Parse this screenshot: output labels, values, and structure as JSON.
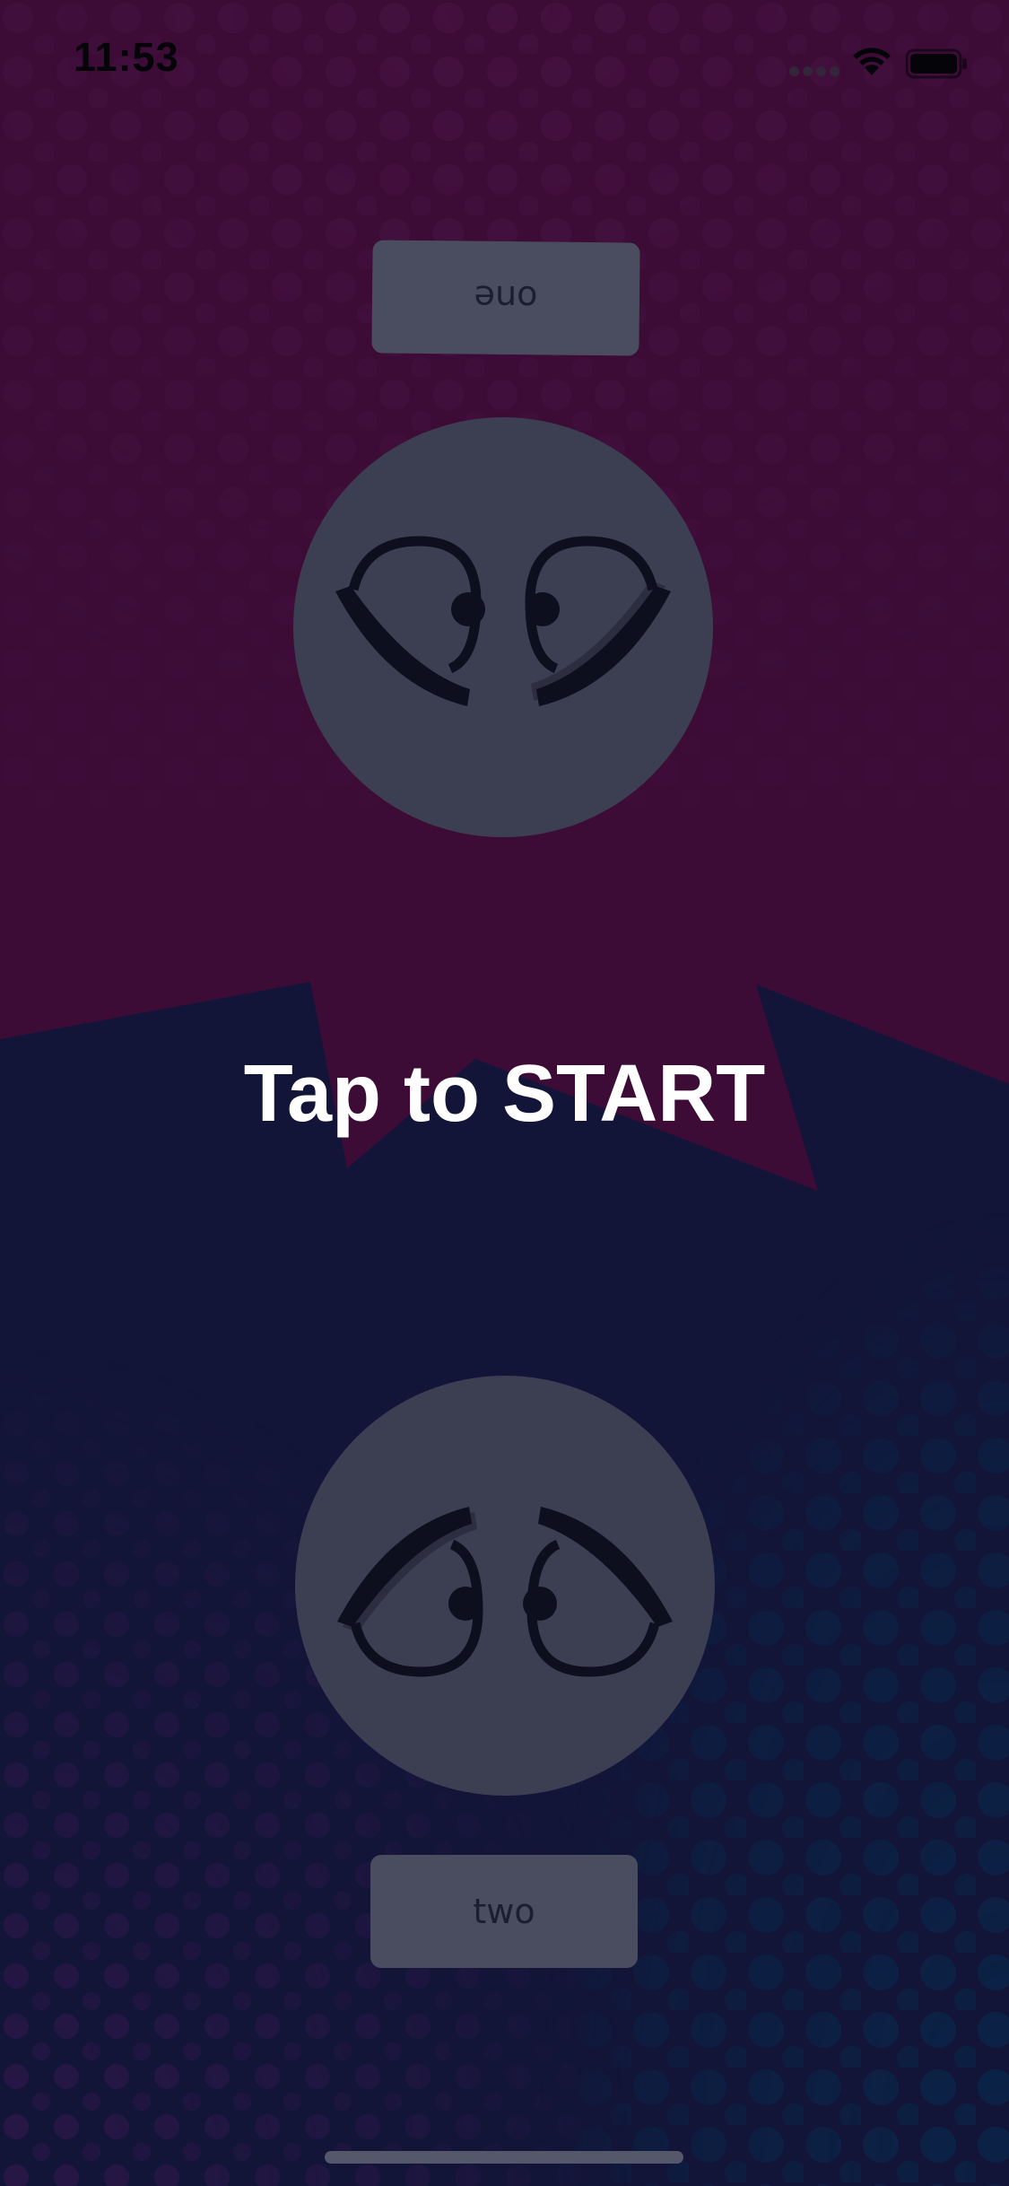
{
  "status_bar": {
    "time": "11:53"
  },
  "players": {
    "top": {
      "button_label": "one",
      "orientation": "upside-down",
      "icon": "eyes-face-icon"
    },
    "bottom": {
      "button_label": "two",
      "orientation": "upright",
      "icon": "eyes-face-icon"
    }
  },
  "start_prompt": "Tap to START",
  "colors": {
    "top_background": "#3c0c37",
    "bottom_background": "#121538",
    "circle": "#3c3f52",
    "button": "#4a4d5f",
    "button_text": "#1c1e30",
    "prompt_text": "#ffffff"
  }
}
